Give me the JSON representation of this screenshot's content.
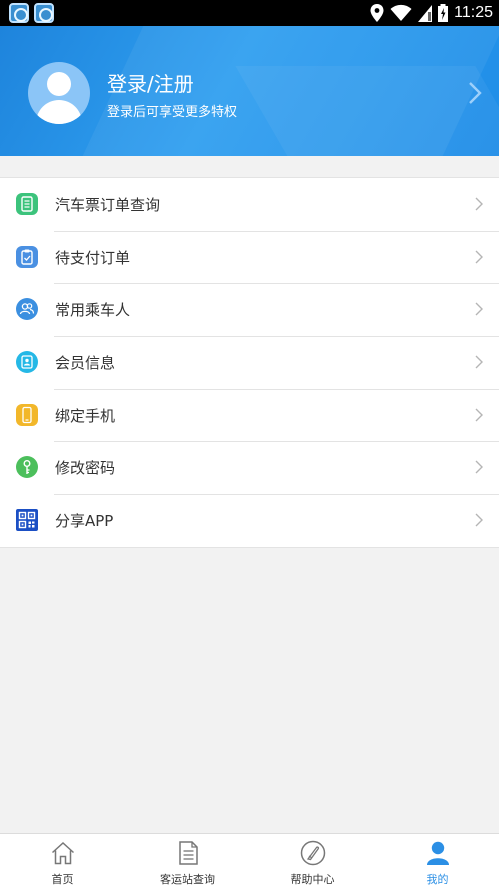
{
  "status_bar": {
    "time": "11:25"
  },
  "header": {
    "login_title": "登录/注册",
    "login_subtitle": "登录后可享受更多特权"
  },
  "menu": {
    "items": [
      {
        "label": "汽车票订单查询",
        "icon": "ticket-order-icon",
        "color": "#3cc37c"
      },
      {
        "label": "待支付订单",
        "icon": "pending-payment-icon",
        "color": "#4a90e2"
      },
      {
        "label": "常用乘车人",
        "icon": "passengers-icon",
        "color": "#3b8fe0"
      },
      {
        "label": "会员信息",
        "icon": "member-info-icon",
        "color": "#25b8e6"
      },
      {
        "label": "绑定手机",
        "icon": "phone-icon",
        "color": "#f2b72a"
      },
      {
        "label": "修改密码",
        "icon": "key-icon",
        "color": "#4cbf5c"
      },
      {
        "label": "分享APP",
        "icon": "qr-code-icon",
        "color": "#1b4fc4"
      }
    ]
  },
  "tabbar": {
    "tabs": [
      {
        "label": "首页",
        "icon": "home-icon"
      },
      {
        "label": "客运站查询",
        "icon": "document-icon"
      },
      {
        "label": "帮助中心",
        "icon": "help-icon"
      },
      {
        "label": "我的",
        "icon": "user-icon",
        "active": true
      }
    ],
    "active_color": "#2b8fe5"
  }
}
